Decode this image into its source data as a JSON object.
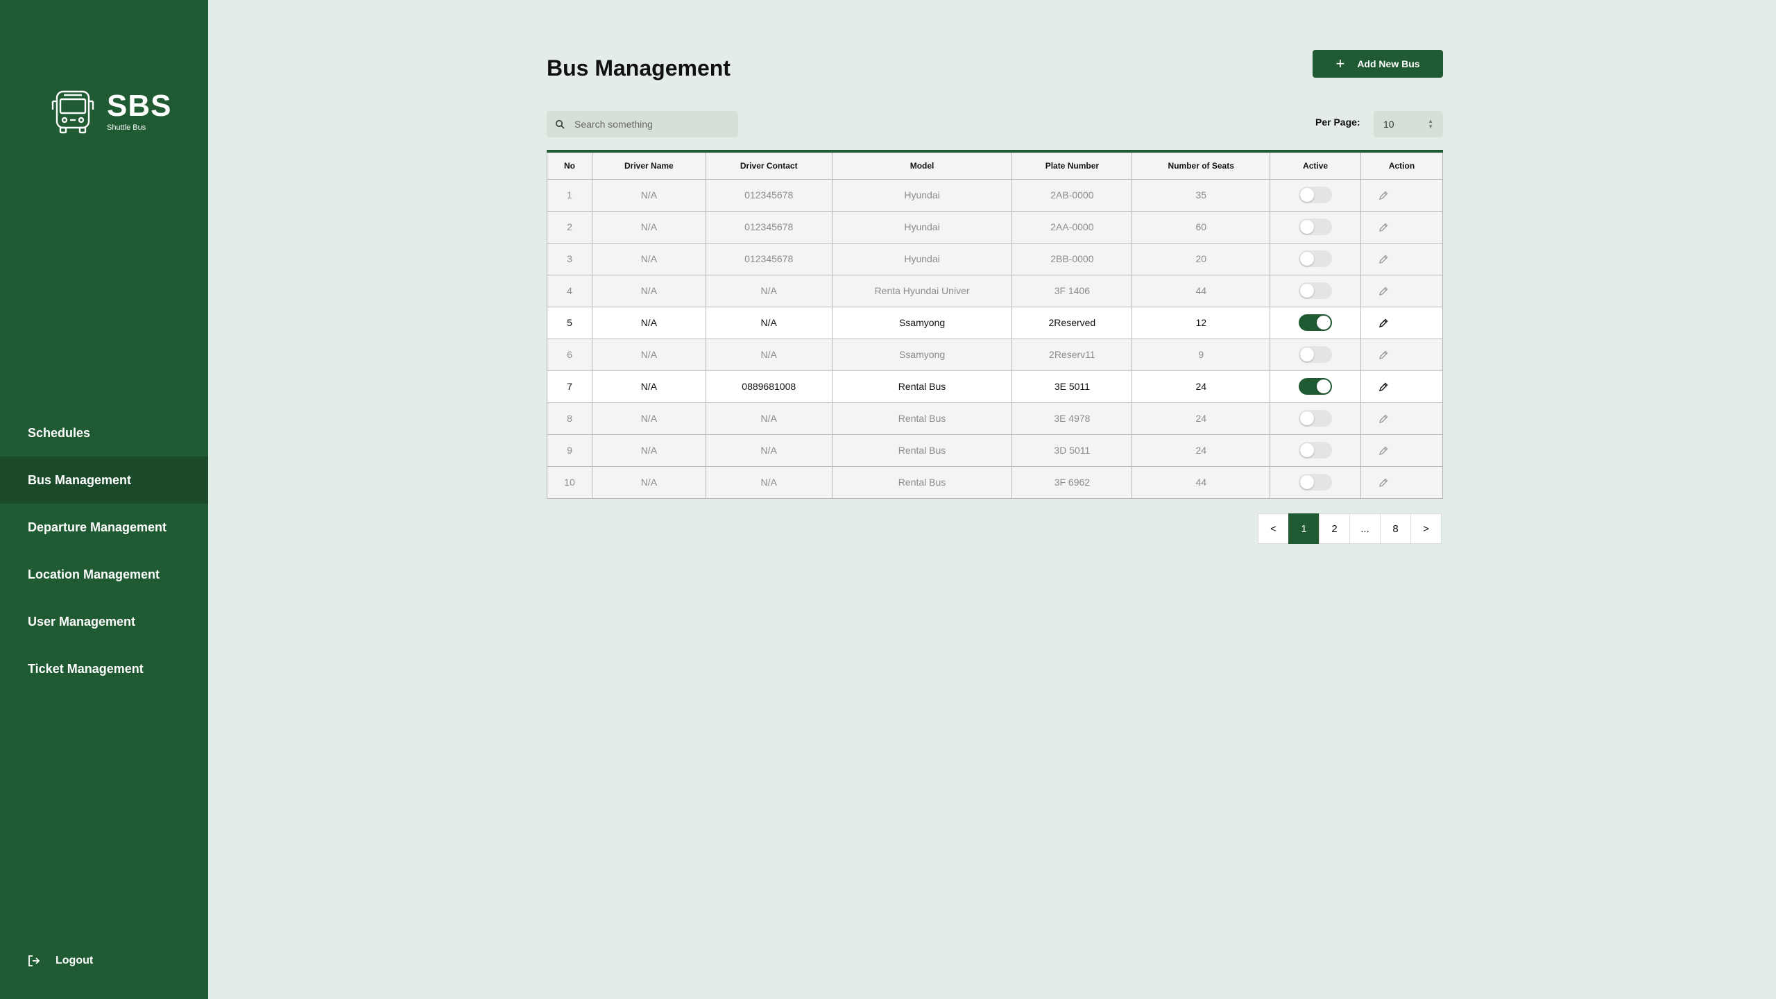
{
  "brand": {
    "title": "SBS",
    "subtitle": "Shuttle Bus"
  },
  "sidebar": {
    "items": [
      {
        "label": "Schedules",
        "active": false
      },
      {
        "label": "Bus Management",
        "active": true
      },
      {
        "label": "Departure Management",
        "active": false
      },
      {
        "label": "Location Management",
        "active": false
      },
      {
        "label": "User Management",
        "active": false
      },
      {
        "label": "Ticket Management",
        "active": false
      }
    ],
    "logout_label": "Logout"
  },
  "page": {
    "title": "Bus Management",
    "add_button_label": "Add New Bus"
  },
  "search": {
    "placeholder": "Search something",
    "value": ""
  },
  "per_page": {
    "label": "Per Page:",
    "value": "10"
  },
  "table": {
    "columns": [
      "No",
      "Driver Name",
      "Driver Contact",
      "Model",
      "Plate Number",
      "Number of Seats",
      "Active",
      "Action"
    ],
    "rows": [
      {
        "no": "1",
        "driver_name": "N/A",
        "driver_contact": "012345678",
        "model": "Hyundai",
        "plate": "2AB-0000",
        "seats": "35",
        "active": false
      },
      {
        "no": "2",
        "driver_name": "N/A",
        "driver_contact": "012345678",
        "model": "Hyundai",
        "plate": "2AA-0000",
        "seats": "60",
        "active": false
      },
      {
        "no": "3",
        "driver_name": "N/A",
        "driver_contact": "012345678",
        "model": "Hyundai",
        "plate": "2BB-0000",
        "seats": "20",
        "active": false
      },
      {
        "no": "4",
        "driver_name": "N/A",
        "driver_contact": "N/A",
        "model": "Renta Hyundai Univer",
        "plate": "3F 1406",
        "seats": "44",
        "active": false
      },
      {
        "no": "5",
        "driver_name": "N/A",
        "driver_contact": "N/A",
        "model": "Ssamyong",
        "plate": "2Reserved",
        "seats": "12",
        "active": true
      },
      {
        "no": "6",
        "driver_name": "N/A",
        "driver_contact": "N/A",
        "model": "Ssamyong",
        "plate": "2Reserv11",
        "seats": "9",
        "active": false
      },
      {
        "no": "7",
        "driver_name": "N/A",
        "driver_contact": "0889681008",
        "model": "Rental Bus",
        "plate": "3E 5011",
        "seats": "24",
        "active": true
      },
      {
        "no": "8",
        "driver_name": "N/A",
        "driver_contact": "N/A",
        "model": "Rental Bus",
        "plate": "3E 4978",
        "seats": "24",
        "active": false
      },
      {
        "no": "9",
        "driver_name": "N/A",
        "driver_contact": "N/A",
        "model": "Rental Bus",
        "plate": "3D 5011",
        "seats": "24",
        "active": false
      },
      {
        "no": "10",
        "driver_name": "N/A",
        "driver_contact": "N/A",
        "model": "Rental Bus",
        "plate": "3F 6962",
        "seats": "44",
        "active": false
      }
    ]
  },
  "pagination": {
    "prev": "<",
    "pages": [
      "1",
      "2",
      "...",
      "8"
    ],
    "current": "1",
    "next": ">"
  },
  "colors": {
    "primary": "#1f5a32",
    "sidebar_active": "#1a4a2a",
    "background": "#e3ece6"
  },
  "icons": [
    "bus-logo-icon",
    "plus-icon",
    "search-icon",
    "edit-pencil-icon",
    "logout-icon",
    "select-arrows-icon"
  ]
}
